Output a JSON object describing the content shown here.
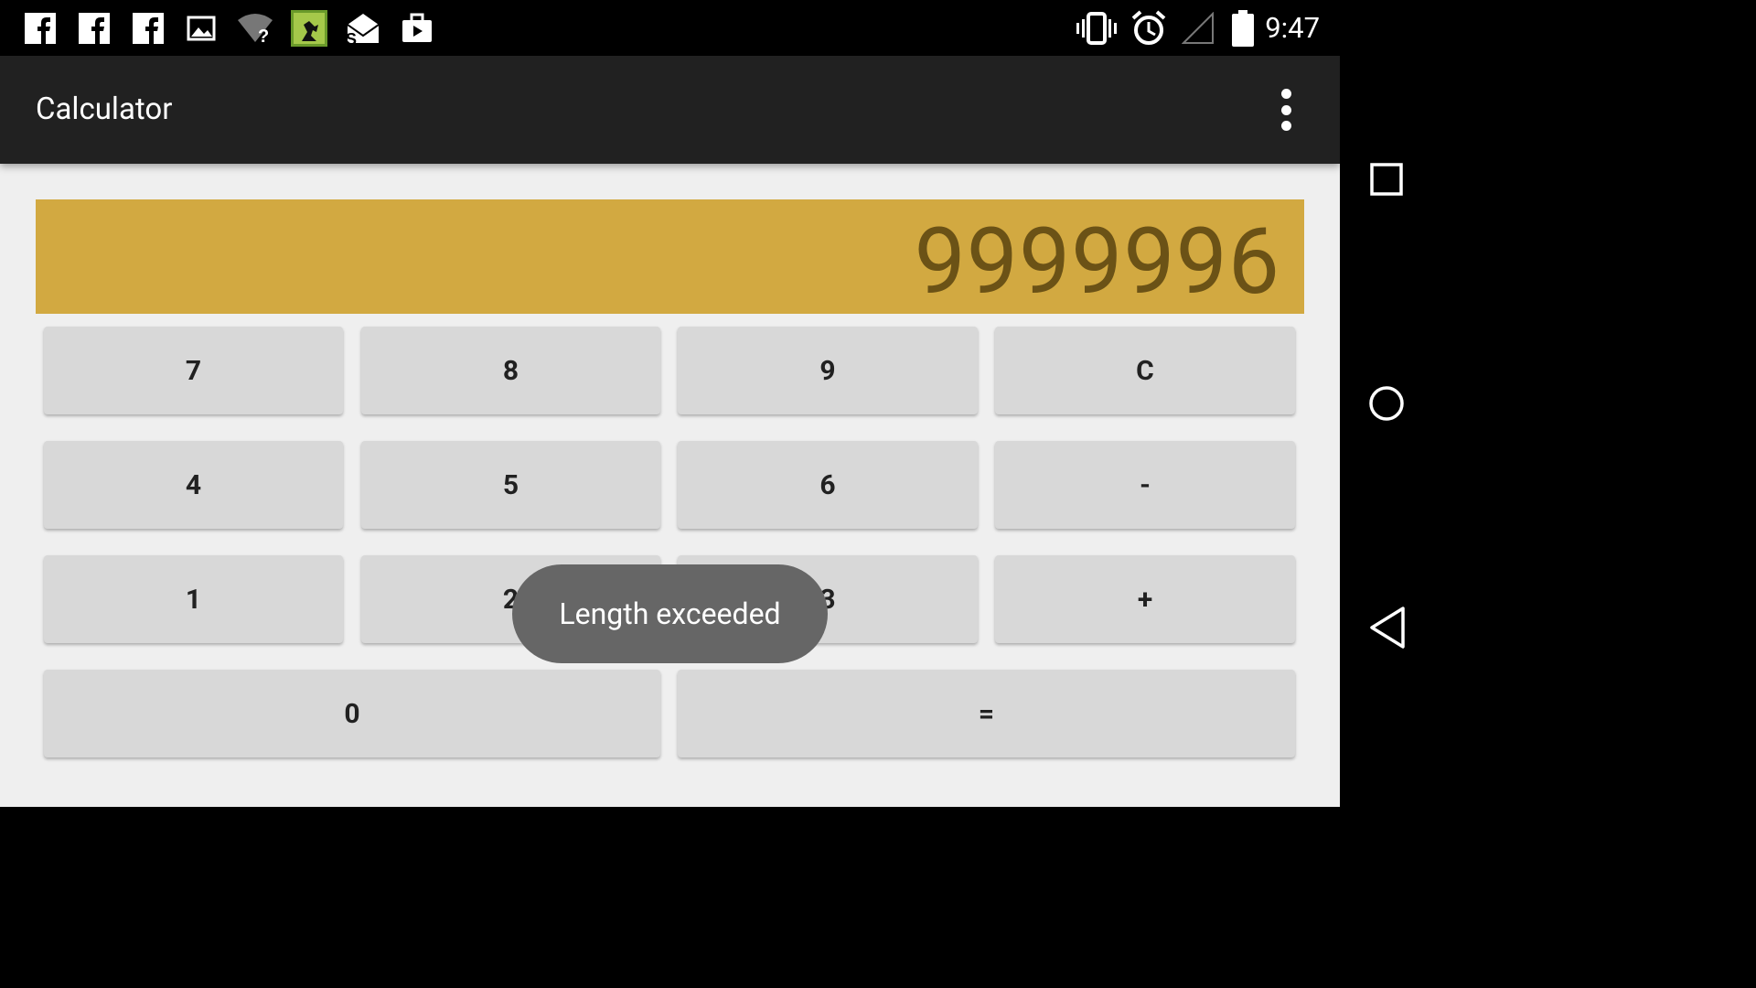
{
  "status_bar": {
    "notification_icons": [
      "facebook-icon",
      "facebook-icon",
      "facebook-icon",
      "image-icon",
      "wifi-question-icon",
      "game-app-icon",
      "mail-app-icon",
      "briefcase-upload-icon"
    ],
    "system_icons": [
      "vibrate-icon",
      "alarm-icon",
      "no-signal-icon",
      "battery-full-icon"
    ],
    "time": "9:47"
  },
  "app_bar": {
    "title": "Calculator",
    "overflow_icon": "more-vert-icon"
  },
  "display": {
    "value": "9999996",
    "background_color": "#d2a941",
    "text_color": "#6b5216"
  },
  "keypad": {
    "rows": [
      [
        "7",
        "8",
        "9",
        "C"
      ],
      [
        "4",
        "5",
        "6",
        "-"
      ],
      [
        "1",
        "2",
        "3",
        "+"
      ],
      [
        "0",
        "="
      ]
    ]
  },
  "toast": {
    "message": "Length exceeded"
  },
  "nav_bar": {
    "buttons": [
      "recents-icon",
      "home-icon",
      "back-icon"
    ]
  }
}
